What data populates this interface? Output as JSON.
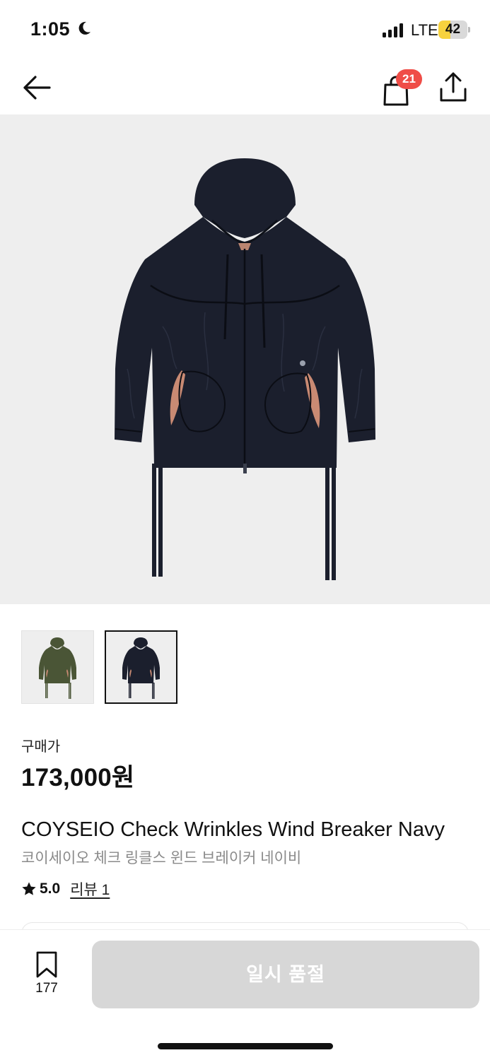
{
  "status_bar": {
    "time": "1:05",
    "network": "LTE",
    "battery_level": "42",
    "battery_percent": 42,
    "battery_color": "#f7d23e",
    "icons": [
      "moon-icon",
      "signal-icon"
    ]
  },
  "nav": {
    "back_icon": "back-arrow-icon",
    "bag_icon": "shopping-bag-icon",
    "bag_count": "21",
    "badge_color": "#ef4d47",
    "share_icon": "share-icon"
  },
  "gallery": {
    "thumbnails": [
      {
        "variant": "olive",
        "color": "#4a5536",
        "selected": false
      },
      {
        "variant": "navy",
        "color": "#1b1f2d",
        "selected": true
      }
    ]
  },
  "product": {
    "price_label": "구매가",
    "price": "173,000원",
    "title_en": "COYSEIO Check Wrinkles Wind Breaker Navy",
    "title_ko": "코이세이오 체크 링클스 윈드 브레이커 네이비",
    "rating": "5.0",
    "review_label": "리뷰 1"
  },
  "bottom_bar": {
    "wish_count": "177",
    "soldout_label": "일시 품절"
  }
}
